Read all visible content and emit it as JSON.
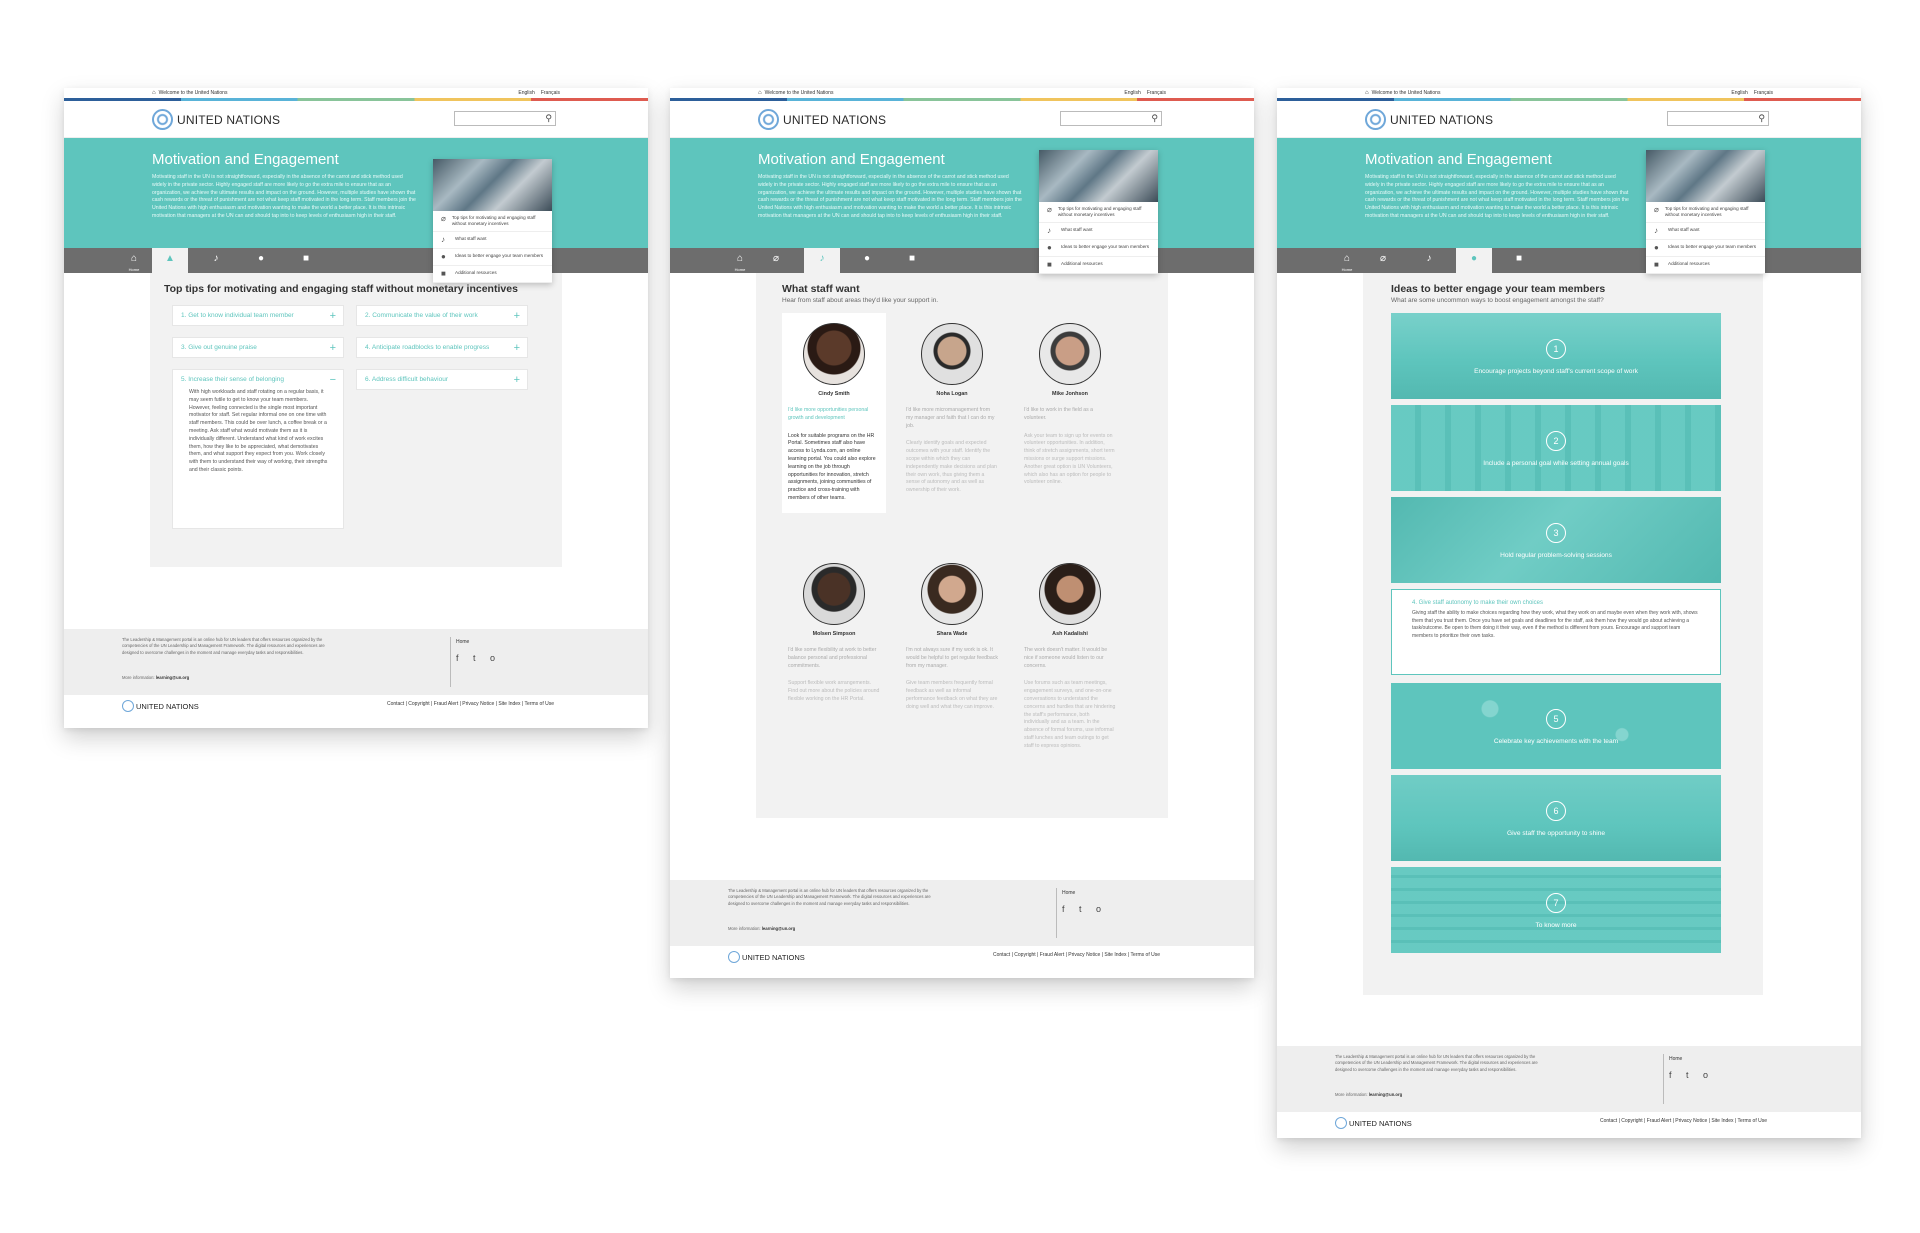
{
  "common": {
    "welcome": "Welcome to the United Nations",
    "lang_en": "English",
    "lang_fr": "Français",
    "org_name": "UNITED NATIONS",
    "hero_title": "Motivation and Engagement",
    "hero_text": "Motivating staff in the UN is not straightforward, especially in the absence of the carrot and stick method used widely in the private sector. Highly engaged staff are more likely to go the extra mile to ensure that as an organization, we achieve the ultimate results and impact on the ground. However, multiple studies have shown that cash rewards or the threat of punishment are not what keep staff motivated in the long term. Staff members join the United Nations with high enthusiasm and motivation wanting to make the world a better place. It is this intrinsic motivation that managers at the UN can and should tap into to keep levels of enthusiasm high in their staff.",
    "home_caption": "Home",
    "menu": [
      "Top tips for motivating and engaging staff without monetary incentives",
      "What staff want",
      "Ideas to better engage your team members",
      "Additional resources"
    ],
    "footer_about": "The Leadership & Management portal is an online hub for UN leaders that offers resources organized by the competencies of the UN Leadership and Management Framework. The digital resources and experiences are designed to overcome challenges in the moment and manage everyday tasks and responsibilities.",
    "footer_more_label": "More information:",
    "footer_email": "learning@un.org",
    "footer_home": "Home",
    "footer_social": "f  t  o",
    "footer_links": "Contact | Copyright | Fraud Alert | Privacy Notice | Site Index | Terms of Use"
  },
  "page1": {
    "section_title": "Top tips for motivating and engaging staff without monetary incentives",
    "tips": [
      "1. Get to know individual team member",
      "2. Communicate the value of their work",
      "3. Give out genuine praise",
      "4. Anticipate roadblocks to enable progress",
      "5. Increase their sense of belonging",
      "6. Address difficult behaviour"
    ],
    "tip5_body": "With high workloads and staff rotating on a regular basis, it may seem futile to get to know your team members. However, feeling connected is the single most important motivator for staff. Set regular informal one on one time with staff members. This could be over lunch, a coffee break or a meeting. Ask staff what would motivate them as it is individually different. Understand what kind of work excites them, how they like to be appreciated, what demotivates them, and what support they expect from you. Work closely with them to understand their way of working, their strengths and their classic points."
  },
  "page2": {
    "section_title": "What staff want",
    "section_sub": "Hear from staff about areas they'd like your support in.",
    "staff": [
      {
        "name": "Cindy Smith",
        "quote": "I'd like more opportunities personal growth and development",
        "body": "Look for suitable programs on the HR Portal. Sometimes staff also have access to Lynda.com, an online learning portal. You could also explore learning on the job through opportunities for innovation, stretch assignments, joining communities of practice and cross-training with members of other teams."
      },
      {
        "name": "Noha Logan",
        "quote": "I'd like more micromanagement from my manager and faith that I can do my job.",
        "body": "Clearly identify goals and expected outcomes with your staff. Identify the scope within which they can independently make decisions and plan their own work, thus giving them a sense of autonomy and as well as ownership of their work."
      },
      {
        "name": "Mike Jonhson",
        "quote": "I'd like to work in the field as a volunteer.",
        "body": "Ask your team to sign up for events on volunteer opportunities. In addition, think of stretch assignments, short term missions or surge support missions. Another great option is UN Volunteers, which also has an option for people to volunteer online."
      },
      {
        "name": "Molsen Simpson",
        "quote": "I'd like some flexibility at work to better balance personal and professional commitments.",
        "body": "Support flexible work arrangements. Find out more about the policies around flexible working on the HR Portal."
      },
      {
        "name": "Shara Wade",
        "quote": "I'm not always sure if my work is ok. It would be helpful to get regular feedback from my manager.",
        "body": "Give team members frequently formal feedback as well as informal performance feedback on what they are doing well and what they can improve."
      },
      {
        "name": "Ash Kadalishi",
        "quote": "The work doesn't matter. It would be nice if someone would listen to our concerns.",
        "body": "Use forums such as team meetings, engagement surveys, and one-on-one conversations to understand the concerns and hurdles that are hindering the staff's performance, both individually and as a team. In the absence of formal forums, use informal staff lunches and team outings to get staff to express opinions."
      }
    ]
  },
  "page3": {
    "section_title": "Ideas to better engage your team members",
    "section_sub": "What are some uncommon ways to boost engagement amongst the staff?",
    "ideas": [
      {
        "num": "1",
        "label": "Encourage projects beyond staff's current scope of work"
      },
      {
        "num": "2",
        "label": "Include a personal goal while setting annual goals"
      },
      {
        "num": "3",
        "label": "Hold regular problem-solving sessions"
      },
      {
        "num": "4",
        "label": "4. Give staff autonomy to make their own choices",
        "body": "Giving staff the ability to make choices regarding how they work, what they work on and maybe even when they work with, shows them that you trust them. Once you have set goals and deadlines for the staff, ask them how they would go about achieving a task/outcome. Be open to them doing it their way, even if the method is different from yours. Encourage and support team members to prioritize their own tasks."
      },
      {
        "num": "5",
        "label": "Celebrate key achievements with the team"
      },
      {
        "num": "6",
        "label": "Give staff the opportunity to shine"
      },
      {
        "num": "7",
        "label": "To know more"
      }
    ]
  }
}
